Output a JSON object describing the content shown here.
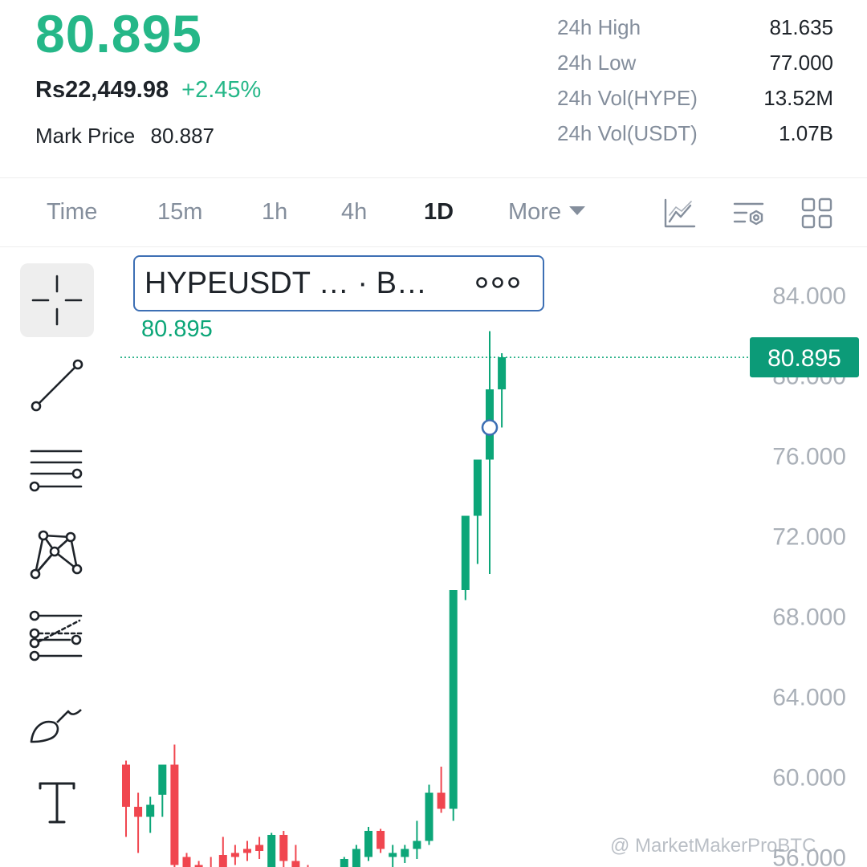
{
  "colors": {
    "up": "#25b788",
    "candle_up": "#0ca678",
    "down": "#f0464f",
    "axis_text": "#aab0b8",
    "price_tag_bg": "#0c9b78",
    "accent_blue": "#3d6fb4"
  },
  "header": {
    "last_price": "80.895",
    "fiat_price": "Rs22,449.98",
    "change_pct": "+2.45%",
    "mark_label": "Mark Price",
    "mark_value": "80.887",
    "stats": [
      {
        "label": "24h High",
        "value": "81.635"
      },
      {
        "label": "24h Low",
        "value": "77.000"
      },
      {
        "label": "24h Vol(HYPE)",
        "value": "13.52M"
      },
      {
        "label": "24h Vol(USDT)",
        "value": "1.07B"
      }
    ]
  },
  "tabs": {
    "items": [
      "Time",
      "15m",
      "1h",
      "4h",
      "1D"
    ],
    "active": "1D",
    "more_label": "More",
    "tool_icons": [
      "indicator-chart-icon",
      "chart-settings-icon",
      "layout-grid-icon"
    ]
  },
  "left_toolbar": {
    "icons": [
      "crosshair-icon",
      "trend-line-icon",
      "horizontal-lines-icon",
      "pattern-icon",
      "fibonacci-icon",
      "brush-icon",
      "text-tool-icon"
    ]
  },
  "legend": {
    "symbol": "HYPEUSDT …   · B…",
    "close_value": "80.895"
  },
  "chart_data": {
    "type": "candlestick",
    "title": "",
    "y_axis_ticks": [
      "84.000",
      "80.000",
      "76.000",
      "72.000",
      "68.000",
      "64.000",
      "60.000",
      "56.000"
    ],
    "ylim": [
      55.5,
      86.3
    ],
    "current_price_label": "80.895",
    "current_price": 80.895,
    "candles": [
      {
        "o": 60.6,
        "h": 60.8,
        "l": 57.0,
        "c": 58.5
      },
      {
        "o": 58.5,
        "h": 59.2,
        "l": 56.2,
        "c": 58.0
      },
      {
        "o": 58.0,
        "h": 59.0,
        "l": 57.2,
        "c": 58.6
      },
      {
        "o": 59.1,
        "h": 60.2,
        "l": 58.0,
        "c": 60.6
      },
      {
        "o": 60.6,
        "h": 61.6,
        "l": 55.0,
        "c": 55.6
      },
      {
        "o": 56.0,
        "h": 56.2,
        "l": 54.5,
        "c": 54.8
      },
      {
        "o": 55.6,
        "h": 55.8,
        "l": 54.8,
        "c": 55.0
      },
      {
        "o": 55.5,
        "h": 56.0,
        "l": 55.0,
        "c": 55.2
      },
      {
        "o": 56.1,
        "h": 57.0,
        "l": 55.3,
        "c": 55.5
      },
      {
        "o": 56.2,
        "h": 56.6,
        "l": 55.6,
        "c": 56.0
      },
      {
        "o": 56.4,
        "h": 56.8,
        "l": 55.8,
        "c": 56.2
      },
      {
        "o": 56.6,
        "h": 57.0,
        "l": 55.9,
        "c": 56.3
      },
      {
        "o": 55.5,
        "h": 57.2,
        "l": 55.0,
        "c": 57.1
      },
      {
        "o": 57.1,
        "h": 57.3,
        "l": 55.4,
        "c": 55.8
      },
      {
        "o": 55.8,
        "h": 56.6,
        "l": 55.2,
        "c": 55.4
      },
      {
        "o": 55.2,
        "h": 55.6,
        "l": 54.8,
        "c": 55.0
      },
      {
        "o": 55.0,
        "h": 55.4,
        "l": 54.9,
        "c": 55.1
      },
      {
        "o": 55.1,
        "h": 55.5,
        "l": 55.0,
        "c": 55.3
      },
      {
        "o": 55.3,
        "h": 56.0,
        "l": 55.1,
        "c": 55.9
      },
      {
        "o": 55.5,
        "h": 56.6,
        "l": 55.0,
        "c": 56.4
      },
      {
        "o": 56.0,
        "h": 57.5,
        "l": 55.8,
        "c": 57.3
      },
      {
        "o": 57.3,
        "h": 57.4,
        "l": 56.2,
        "c": 56.4
      },
      {
        "o": 56.0,
        "h": 56.6,
        "l": 55.4,
        "c": 56.2
      },
      {
        "o": 56.0,
        "h": 56.6,
        "l": 55.7,
        "c": 56.4
      },
      {
        "o": 56.4,
        "h": 57.8,
        "l": 55.9,
        "c": 56.8
      },
      {
        "o": 56.8,
        "h": 59.6,
        "l": 56.6,
        "c": 59.2
      },
      {
        "o": 59.2,
        "h": 60.5,
        "l": 58.2,
        "c": 58.4
      },
      {
        "o": 58.4,
        "h": 69.3,
        "l": 57.8,
        "c": 69.3
      },
      {
        "o": 69.3,
        "h": 73.0,
        "l": 68.8,
        "c": 73.0
      },
      {
        "o": 73.0,
        "h": 75.8,
        "l": 70.6,
        "c": 75.8
      },
      {
        "o": 75.8,
        "h": 82.2,
        "l": 70.1,
        "c": 79.3
      },
      {
        "o": 79.3,
        "h": 81.1,
        "l": 77.4,
        "c": 80.9
      }
    ]
  },
  "watermark": "@ MarketMakerProBTC"
}
